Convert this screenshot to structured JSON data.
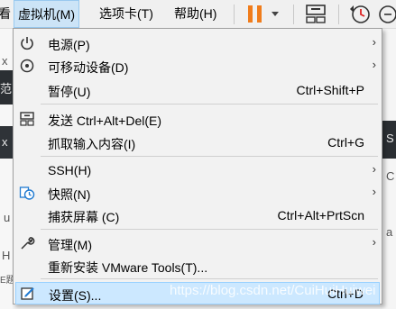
{
  "menubar": {
    "items": [
      "虚拟机(M)",
      "选项卡(T)",
      "帮助(H)"
    ],
    "partial_left": "看"
  },
  "menu": {
    "items": [
      {
        "label": "电源(P)",
        "shortcut": "",
        "submenu": true,
        "icon": "power-icon"
      },
      {
        "label": "可移动设备(D)",
        "shortcut": "",
        "submenu": true,
        "icon": "removable-devices-icon"
      },
      {
        "label": "暂停(U)",
        "shortcut": "Ctrl+Shift+P",
        "submenu": false,
        "icon": ""
      },
      {
        "label": "发送 Ctrl+Alt+Del(E)",
        "shortcut": "",
        "submenu": false,
        "icon": "send-keys-icon"
      },
      {
        "label": "抓取输入内容(I)",
        "shortcut": "Ctrl+G",
        "submenu": false,
        "icon": ""
      },
      {
        "label": "SSH(H)",
        "shortcut": "",
        "submenu": true,
        "icon": ""
      },
      {
        "label": "快照(N)",
        "shortcut": "",
        "submenu": true,
        "icon": "snapshot-icon"
      },
      {
        "label": "捕获屏幕 (C)",
        "shortcut": "Ctrl+Alt+PrtScn",
        "submenu": false,
        "icon": ""
      },
      {
        "label": "管理(M)",
        "shortcut": "",
        "submenu": true,
        "icon": "wrench-icon"
      },
      {
        "label": "重新安装 VMware Tools(T)...",
        "shortcut": "",
        "submenu": false,
        "icon": ""
      },
      {
        "label": "设置(S)...",
        "shortcut": "Ctrl+D",
        "submenu": false,
        "icon": "settings-icon"
      }
    ]
  },
  "background": {
    "left_chars": [
      "x",
      "范",
      "x",
      "u",
      "H",
      "E题"
    ],
    "right_chars": [
      "S",
      "C",
      "a"
    ]
  },
  "watermark": "https://blog.csdn.net/CuiHuiHuiwei",
  "colors": {
    "highlight": "#cce8ff",
    "pause_orange": "#f07c1b",
    "icon_blue": "#1f7ad1"
  }
}
